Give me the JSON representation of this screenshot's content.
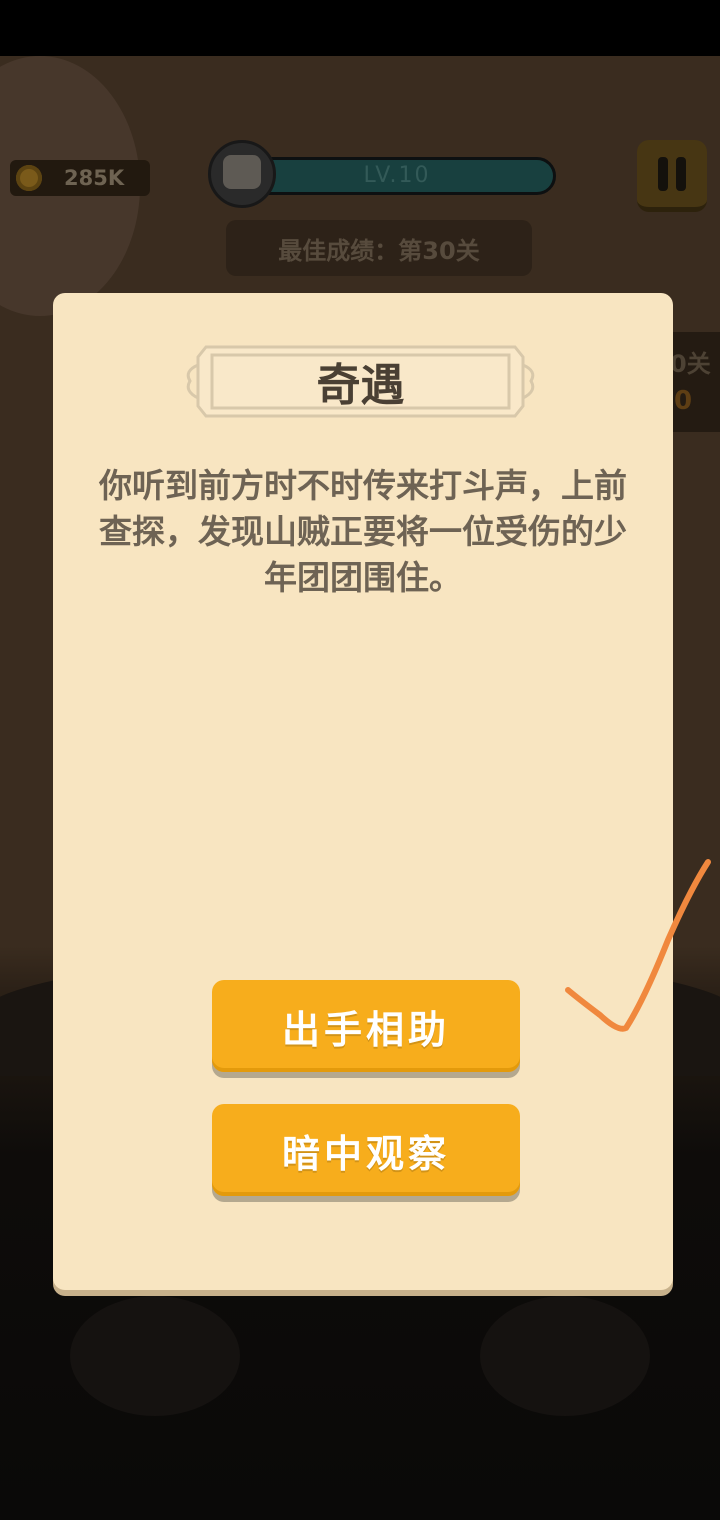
{
  "hud": {
    "coins": "285K",
    "level": "LV.10",
    "level_progress": 1.0,
    "best_score": "最佳成绩：第30关",
    "side_tag_text": "0关",
    "side_tag_num": "0"
  },
  "dialog": {
    "title": "奇遇",
    "story": "你听到前方时不时传来打斗声，上前查探，发现山贼正要将一位受伤的少年团团围住。",
    "options": [
      "出手相助",
      "暗中观察"
    ]
  },
  "colors": {
    "panel": "#f8e5c1",
    "button": "#f7ad1c",
    "annotation": "#f0883e"
  },
  "icons": {
    "coin": "coin-icon",
    "pause": "pause-icon",
    "avatar": "panda-avatar-icon",
    "annotation": "checkmark-annotation-icon"
  }
}
